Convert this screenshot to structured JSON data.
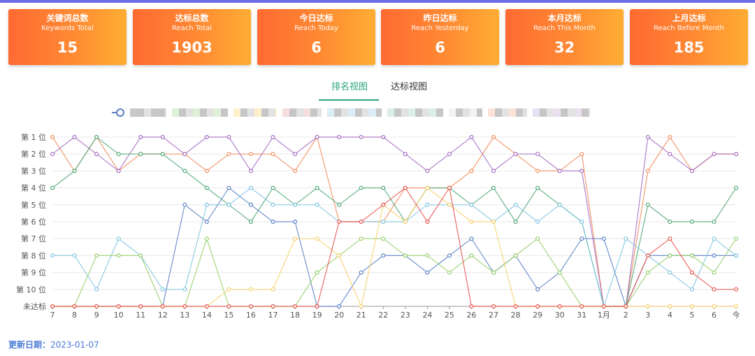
{
  "cards": [
    {
      "title": "关键词总数",
      "subtitle": "Keywords Total",
      "value": "15"
    },
    {
      "title": "达标总数",
      "subtitle": "Reach Total",
      "value": "1903"
    },
    {
      "title": "今日达标",
      "subtitle": "Reach Today",
      "value": "6"
    },
    {
      "title": "昨日达标",
      "subtitle": "Reach Yesterday",
      "value": "6"
    },
    {
      "title": "本月达标",
      "subtitle": "Reach This Month",
      "value": "32"
    },
    {
      "title": "上月达标",
      "subtitle": "Reach Before Month",
      "value": "185"
    }
  ],
  "tabs": [
    {
      "label": "排名视图",
      "active": true
    },
    {
      "label": "达标视图",
      "active": false
    }
  ],
  "legend": {
    "colors": [
      "#c8c8c8",
      "#dff0d8",
      "#fff0cc",
      "#f6dede",
      "#dbeef7",
      "#dcefe6",
      "#f3f3f3",
      "#fde3d6",
      "#e9e0f0"
    ]
  },
  "footer": {
    "label": "更新日期：",
    "value": "2023-01-07"
  },
  "chart_data": {
    "type": "line",
    "x": [
      "7",
      "8",
      "9",
      "10",
      "11",
      "12",
      "13",
      "14",
      "15",
      "16",
      "17",
      "18",
      "19",
      "20",
      "21",
      "22",
      "23",
      "24",
      "25",
      "26",
      "27",
      "28",
      "29",
      "30",
      "31",
      "1月",
      "2",
      "3",
      "4",
      "5",
      "6",
      "今"
    ],
    "y_categories": [
      "第 1 位",
      "第 2 位",
      "第 3 位",
      "第 4 位",
      "第 5 位",
      "第 6 位",
      "第 7 位",
      "第 8 位",
      "第 9 位",
      "第 10 位",
      "未达标"
    ],
    "grid": true,
    "series": [
      {
        "color": "#f08c5a",
        "values": [
          1,
          3,
          1,
          3,
          2,
          2,
          2,
          3,
          2,
          2,
          2,
          3,
          1,
          6,
          6,
          6,
          4,
          4,
          4,
          3,
          1,
          2,
          3,
          3,
          2,
          11,
          11,
          3,
          1,
          3,
          2,
          2
        ]
      },
      {
        "color": "#a46cc2",
        "values": [
          2,
          1,
          2,
          3,
          1,
          1,
          2,
          1,
          1,
          3,
          1,
          2,
          1,
          1,
          1,
          1,
          2,
          3,
          2,
          1,
          3,
          2,
          2,
          3,
          3,
          11,
          11,
          1,
          2,
          3,
          2,
          2
        ]
      },
      {
        "color": "#4fa877",
        "values": [
          4,
          3,
          1,
          2,
          2,
          2,
          3,
          4,
          5,
          6,
          4,
          5,
          4,
          5,
          4,
          4,
          6,
          4,
          4,
          5,
          4,
          6,
          4,
          5,
          6,
          11,
          11,
          5,
          6,
          6,
          6,
          4
        ]
      },
      {
        "color": "#5b7fc6",
        "values": [
          11,
          11,
          11,
          11,
          11,
          11,
          5,
          6,
          4,
          5,
          6,
          6,
          11,
          11,
          9,
          8,
          8,
          9,
          8,
          7,
          9,
          8,
          10,
          9,
          7,
          7,
          11,
          8,
          8,
          8,
          8,
          8
        ]
      },
      {
        "color": "#7fc5e0",
        "values": [
          8,
          8,
          10,
          7,
          8,
          10,
          10,
          5,
          5,
          4,
          5,
          5,
          5,
          6,
          6,
          6,
          6,
          5,
          5,
          5,
          6,
          5,
          6,
          5,
          6,
          11,
          7,
          8,
          9,
          10,
          7,
          8
        ]
      },
      {
        "color": "#96cf6a",
        "values": [
          11,
          11,
          8,
          8,
          8,
          11,
          11,
          7,
          11,
          11,
          11,
          11,
          9,
          8,
          7,
          7,
          8,
          8,
          9,
          8,
          9,
          8,
          7,
          9,
          11,
          11,
          11,
          9,
          8,
          8,
          9,
          7
        ]
      },
      {
        "color": "#f7d06a",
        "values": [
          11,
          11,
          11,
          11,
          11,
          11,
          11,
          11,
          10,
          10,
          10,
          7,
          7,
          8,
          11,
          5,
          6,
          4,
          5,
          6,
          6,
          11,
          11,
          11,
          11,
          11,
          11,
          11,
          11,
          11,
          11,
          11
        ]
      },
      {
        "color": "#e8534d",
        "values": [
          11,
          11,
          11,
          11,
          11,
          11,
          11,
          11,
          11,
          11,
          11,
          11,
          11,
          6,
          6,
          5,
          4,
          6,
          4,
          11,
          11,
          11,
          11,
          11,
          11,
          11,
          11,
          8,
          7,
          9,
          10,
          10
        ]
      }
    ]
  }
}
